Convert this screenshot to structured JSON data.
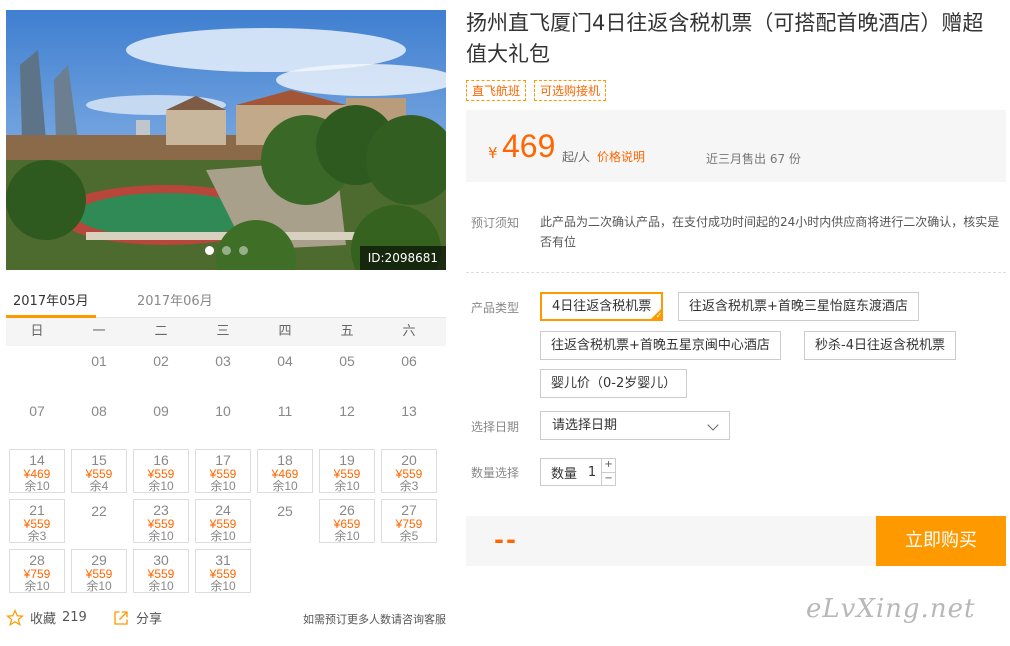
{
  "photo": {
    "id_label": "ID:2098681",
    "slide_count": 3,
    "active_slide": 1
  },
  "calendar": {
    "tabs": [
      {
        "label": "2017年05月",
        "active": true
      },
      {
        "label": "2017年06月",
        "active": false
      }
    ],
    "weekdays": [
      "日",
      "一",
      "二",
      "三",
      "四",
      "五",
      "六"
    ],
    "weeks": [
      [
        null,
        {
          "day": "01"
        },
        {
          "day": "02"
        },
        {
          "day": "03"
        },
        {
          "day": "04"
        },
        {
          "day": "05"
        },
        {
          "day": "06"
        }
      ],
      [
        {
          "day": "07"
        },
        {
          "day": "08"
        },
        {
          "day": "09"
        },
        {
          "day": "10"
        },
        {
          "day": "11"
        },
        {
          "day": "12"
        },
        {
          "day": "13"
        }
      ],
      [
        {
          "day": "14",
          "price": "¥469",
          "stock": "余10"
        },
        {
          "day": "15",
          "price": "¥559",
          "stock": "余4"
        },
        {
          "day": "16",
          "price": "¥559",
          "stock": "余10"
        },
        {
          "day": "17",
          "price": "¥559",
          "stock": "余10"
        },
        {
          "day": "18",
          "price": "¥469",
          "stock": "余10"
        },
        {
          "day": "19",
          "price": "¥559",
          "stock": "余10"
        },
        {
          "day": "20",
          "price": "¥559",
          "stock": "余3"
        }
      ],
      [
        {
          "day": "21",
          "price": "¥559",
          "stock": "余3"
        },
        {
          "day": "22"
        },
        {
          "day": "23",
          "price": "¥559",
          "stock": "余10"
        },
        {
          "day": "24",
          "price": "¥559",
          "stock": "余10"
        },
        {
          "day": "25"
        },
        {
          "day": "26",
          "price": "¥659",
          "stock": "余10"
        },
        {
          "day": "27",
          "price": "¥759",
          "stock": "余5"
        }
      ],
      [
        {
          "day": "28",
          "price": "¥759",
          "stock": "余10"
        },
        {
          "day": "29",
          "price": "¥559",
          "stock": "余10"
        },
        {
          "day": "30",
          "price": "¥559",
          "stock": "余10"
        },
        {
          "day": "31",
          "price": "¥559",
          "stock": "余10"
        },
        null,
        null,
        null
      ]
    ]
  },
  "actions": {
    "favorite_label": "收藏",
    "favorite_count": "219",
    "share_label": "分享",
    "note": "如需预订更多人数请咨询客服"
  },
  "product": {
    "title": "扬州直飞厦门4日往返含税机票（可搭配首晚酒店）赠超值大礼包",
    "tags": [
      "直飞航班",
      "可选购接机"
    ],
    "price_symbol": "¥",
    "price": "469",
    "price_unit": "起/人",
    "price_desc_link": "价格说明",
    "sales": "近三月售出 67 份",
    "notice_label": "预订须知",
    "notice_text": "此产品为二次确认产品，在支付成功时间起的24小时内供应商将进行二次确认，核实是否有位",
    "type_label": "产品类型",
    "types": [
      "4日往返含税机票",
      "往返含税机票+首晚三星怡庭东渡酒店",
      "往返含税机票+首晚五星京闽中心酒店",
      "秒杀-4日往返含税机票",
      "婴儿价（0-2岁婴儿）"
    ],
    "selected_type": 0,
    "date_label": "选择日期",
    "date_placeholder": "请选择日期",
    "qty_label_row": "数量选择",
    "qty_label": "数量",
    "qty_value": "1",
    "qty_plus": "+",
    "qty_minus": "−",
    "total": "--",
    "buy_button": "立即购买"
  },
  "watermark": "eLvXing.net",
  "colors": {
    "accent": "#ff9900",
    "price": "#ff6600"
  }
}
